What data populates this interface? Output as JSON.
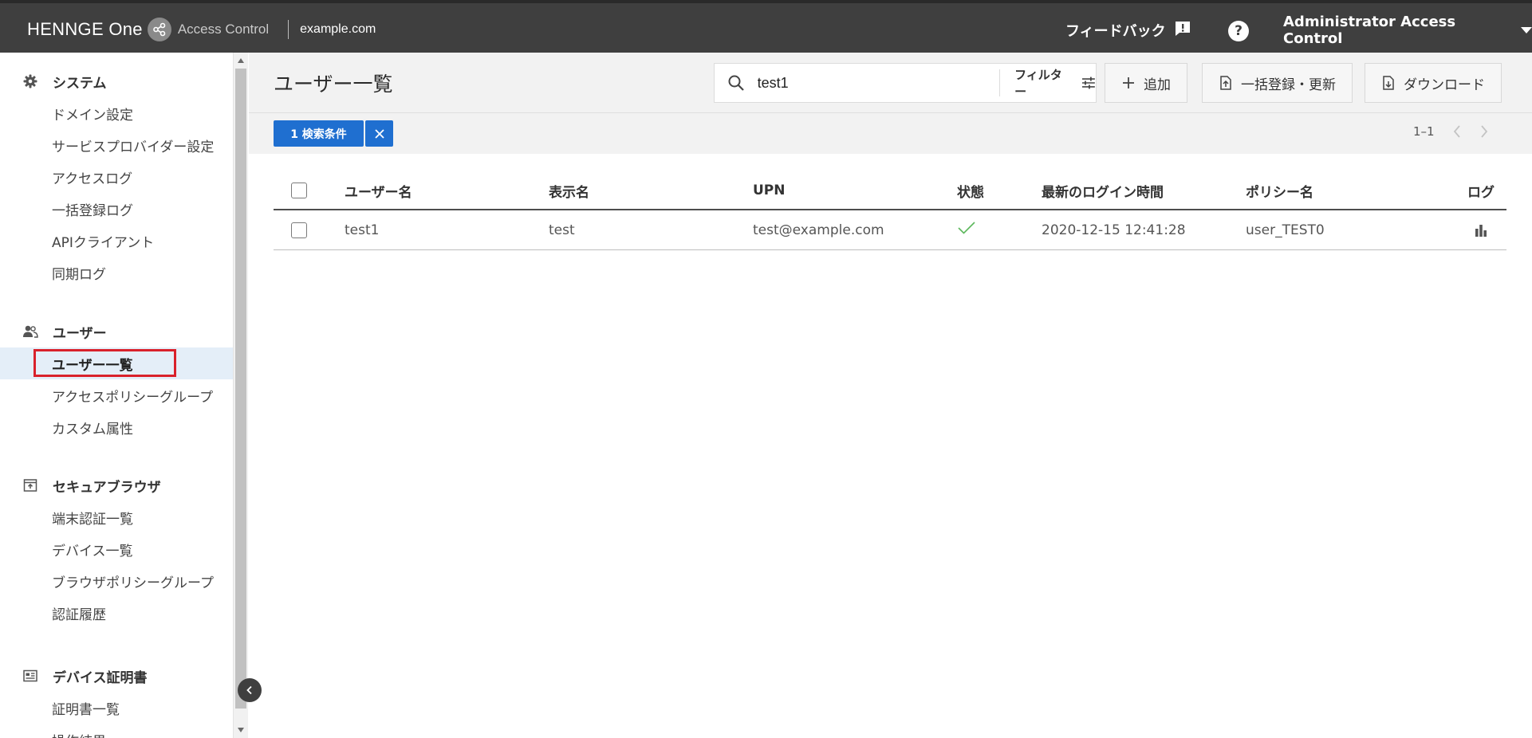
{
  "topbar": {
    "brand": "HENNGE One",
    "product": "Access Control",
    "domain": "example.com",
    "feedback": "フィードバック",
    "help": "?",
    "account": "Administrator Access Control"
  },
  "sidebar": {
    "sections": [
      {
        "title": "システム",
        "icon": "gear-icon",
        "items": [
          "ドメイン設定",
          "サービスプロバイダー設定",
          "アクセスログ",
          "一括登録ログ",
          "APIクライアント",
          "同期ログ"
        ]
      },
      {
        "title": "ユーザー",
        "icon": "users-icon",
        "items": [
          "ユーザー一覧",
          "アクセスポリシーグループ",
          "カスタム属性"
        ],
        "active_index": 0
      },
      {
        "title": "セキュアブラウザ",
        "icon": "secure-browser-icon",
        "items": [
          "端末認証一覧",
          "デバイス一覧",
          "ブラウザポリシーグループ",
          "認証履歴"
        ]
      },
      {
        "title": "デバイス証明書",
        "icon": "certificate-icon",
        "items": [
          "証明書一覧",
          "操作結果"
        ]
      }
    ]
  },
  "main": {
    "title": "ユーザー一覧",
    "search_value": "test1",
    "filter_label": "フィルター",
    "add_label": "追加",
    "bulk_label": "一括登録・更新",
    "download_label": "ダウンロード",
    "chip_label": "1 検索条件",
    "pager_range": "1–1"
  },
  "table": {
    "columns": [
      "ユーザー名",
      "表示名",
      "UPN",
      "状態",
      "最新のログイン時間",
      "ポリシー名",
      "ログ"
    ],
    "rows": [
      {
        "username": "test1",
        "display_name": "test",
        "upn": "test@example.com",
        "status": "active",
        "last_login": "2020-12-15 12:41:28",
        "policy": "user_TEST0",
        "log_icon": "bar-chart-icon"
      }
    ]
  },
  "colors": {
    "topbar": "#3f3f3f",
    "accent": "#1f6fd0",
    "active_nav_bg": "#e4eef8",
    "highlight_box": "#d9212b",
    "status_ok": "#5cb85c"
  }
}
